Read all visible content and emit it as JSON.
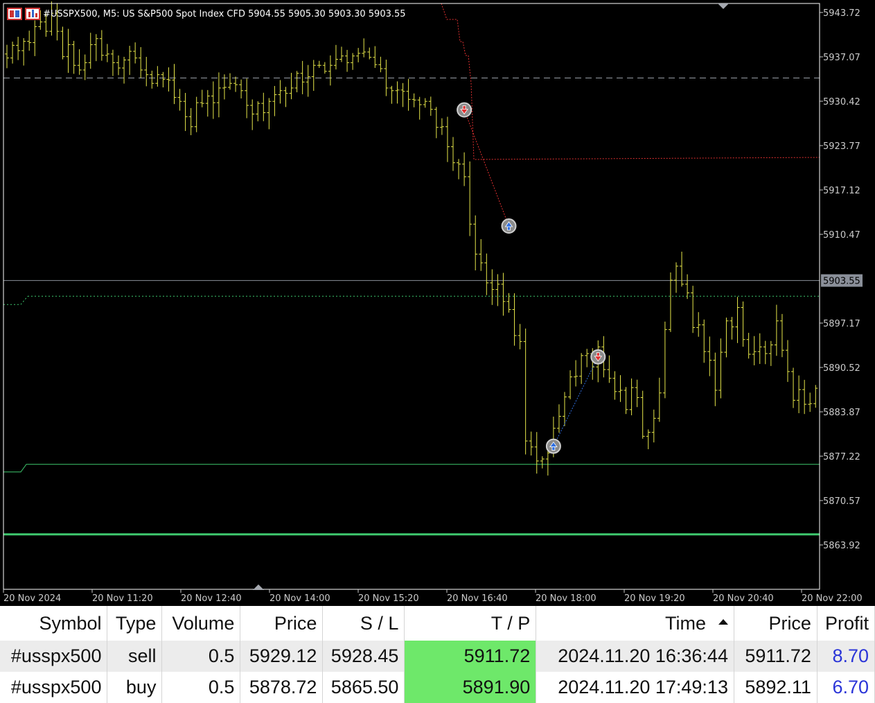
{
  "chart_window": {
    "title": "#USSPX500, M5:  US S&P500 Spot Index CFD  5904.55 5905.30 5903.30 5903.55",
    "symbol": "#USSPX500",
    "timeframe": "M5",
    "current_price_label": "5903.55",
    "colors": {
      "background": "#000000",
      "bars": "#e8e84a",
      "axis_text": "#cccccc",
      "sl_line": "#e03030",
      "tp_line": "#3ec96e",
      "bid_line": "#8a8f99",
      "trade_sell": "#e03030",
      "trade_buy": "#2f6fe0"
    }
  },
  "chart_data": {
    "type": "ohlc",
    "price_ticks": [
      "5943.72",
      "5937.07",
      "5930.42",
      "5923.77",
      "5917.12",
      "5910.47",
      "5903.55",
      "5897.17",
      "5890.52",
      "5883.87",
      "5877.22",
      "5870.57",
      "5863.92"
    ],
    "time_ticks": [
      "20 Nov 2024",
      "20 Nov 11:20",
      "20 Nov 12:40",
      "20 Nov 14:00",
      "20 Nov 15:20",
      "20 Nov 16:40",
      "20 Nov 18:00",
      "20 Nov 19:20",
      "20 Nov 20:40",
      "20 Nov 22:00"
    ],
    "ylim": [
      5862.0,
      5944.5
    ],
    "bar_count": 148,
    "closes": [
      5936.9,
      5938.8,
      5938.0,
      5939.4,
      5939.2,
      5941.6,
      5942.3,
      5940.9,
      5943.6,
      5940.9,
      5937.1,
      5938.9,
      5935.8,
      5935.1,
      5936.2,
      5938.9,
      5939.8,
      5937.3,
      5937.5,
      5936.2,
      5935.4,
      5936.6,
      5937.9,
      5936.9,
      5935.1,
      5934.4,
      5933.1,
      5934.4,
      5933.7,
      5933.6,
      5931.0,
      5930.4,
      5928.1,
      5926.6,
      5930.2,
      5930.1,
      5931.2,
      5930.2,
      5932.4,
      5932.5,
      5933.1,
      5932.9,
      5932.0,
      5929.8,
      5928.5,
      5930.1,
      5928.7,
      5930.4,
      5931.4,
      5932.0,
      5931.6,
      5932.4,
      5934.6,
      5933.3,
      5934.1,
      5935.8,
      5935.8,
      5934.9,
      5935.8,
      5936.7,
      5937.2,
      5936.2,
      5937.2,
      5937.6,
      5937.8,
      5937.0,
      5935.9,
      5935.3,
      5932.4,
      5932.0,
      5932.1,
      5931.9,
      5930.7,
      5930.6,
      5929.9,
      5930.4,
      5929.2,
      5926.5,
      5926.6,
      5923.6,
      5921.2,
      5921.0,
      5919.1,
      5912.0,
      5907.5,
      5906.2,
      5903.2,
      5902.2,
      5903.0,
      5900.4,
      5899.2,
      5895.3,
      5894.4,
      5879.5,
      5878.6,
      5876.5,
      5876.8,
      5877.7,
      5881.4,
      5883.2,
      5886.1,
      5889.1,
      5889.2,
      5892.3,
      5892.6,
      5890.6,
      5893.6,
      5890.2,
      5888.9,
      5886.9,
      5887.1,
      5884.2,
      5887.5,
      5886.0,
      5880.2,
      5880.8,
      5882.9,
      5886.7,
      5896.2,
      5903.6,
      5905.7,
      5903.0,
      5901.7,
      5896.5,
      5896.9,
      5892.9,
      5891.6,
      5887.1,
      5892.8,
      5897.5,
      5896.6,
      5899.5,
      5894.7,
      5892.5,
      5892.9,
      5893.6,
      5892.6,
      5893.9,
      5897.5,
      5893.1,
      5889.9,
      5885.6,
      5887.2,
      5885.0,
      5885.1,
      5887.4,
      5888.5,
      5891.0
    ],
    "levels": {
      "stop_loss_red": 5922.0,
      "take_profit_green": 5876.0,
      "bid": 5903.55,
      "dashed_gray": 5933.9,
      "dotted_green": 5901.2,
      "thick_green": 5865.5
    },
    "trades": [
      {
        "side": "sell",
        "open_bar": 82,
        "open_price": 5929.12,
        "close_bar": 90,
        "close_price": 5911.72
      },
      {
        "side": "buy",
        "open_bar": 98,
        "open_price": 5878.72,
        "close_bar": 106,
        "close_price": 5892.11
      }
    ]
  },
  "positions_table": {
    "headers": {
      "symbol": "Symbol",
      "type": "Type",
      "volume": "Volume",
      "price": "Price",
      "sl": "S / L",
      "tp": "T / P",
      "time": "Time",
      "price2": "Price",
      "profit": "Profit"
    },
    "rows": [
      {
        "symbol": "#usspx500",
        "type": "sell",
        "volume": "0.5",
        "price": "5929.12",
        "sl": "5928.45",
        "tp": "5911.72",
        "time": "2024.11.20 16:36:44",
        "price2": "5911.72",
        "profit": "8.70"
      },
      {
        "symbol": "#usspx500",
        "type": "buy",
        "volume": "0.5",
        "price": "5878.72",
        "sl": "5865.50",
        "tp": "5891.90",
        "time": "2024.11.20 17:49:13",
        "price2": "5892.11",
        "profit": "6.70"
      }
    ]
  }
}
